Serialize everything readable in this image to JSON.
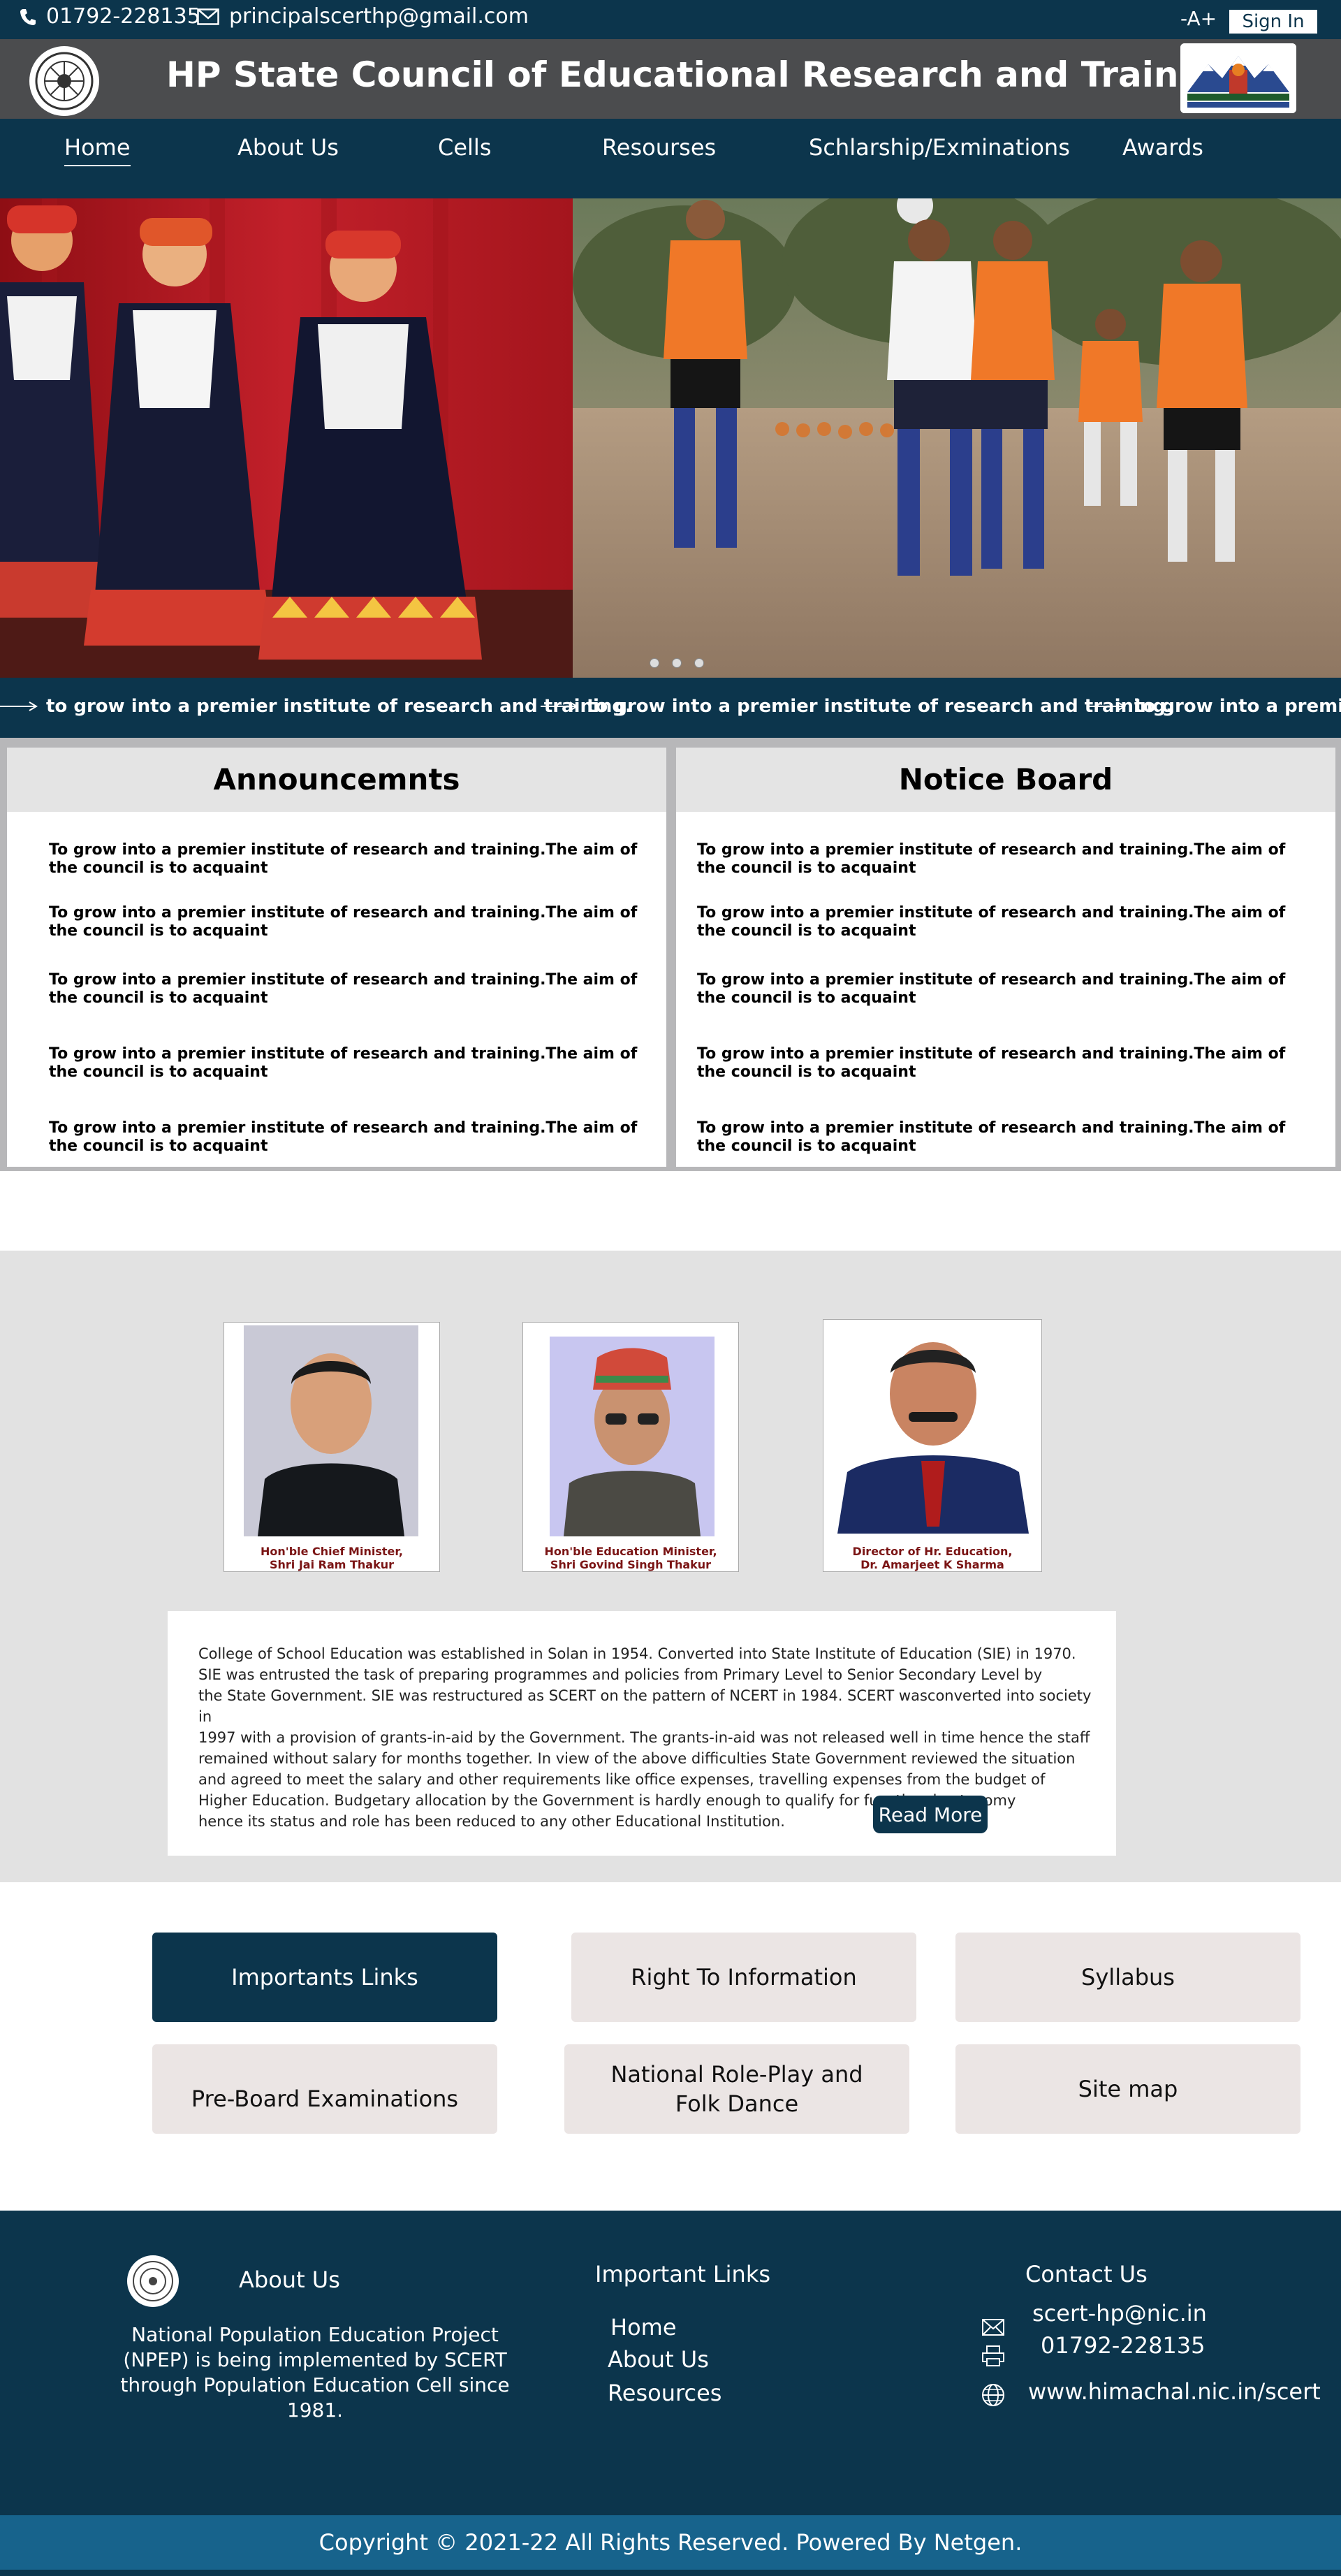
{
  "topbar": {
    "phone": "01792-228135",
    "email": "principalscerthp@gmail.com",
    "font_size_control": "-A+",
    "sign_in": "Sign In"
  },
  "header": {
    "title": "HP State Council of Educational Research and Training"
  },
  "nav": {
    "items": [
      {
        "label": "Home",
        "active": true
      },
      {
        "label": "About Us"
      },
      {
        "label": "Cells"
      },
      {
        "label": "Resourses"
      },
      {
        "label": "Schlarship/Exminations"
      },
      {
        "label": "Awards"
      }
    ]
  },
  "hero": {
    "slide_count": 3,
    "active_slide": 1
  },
  "ticker": {
    "message": "to grow into a premier institute of research and training.",
    "partial": "to grow into a premier ins"
  },
  "announcements": {
    "title": "Announcemnts",
    "entries": [
      "To grow into a premier institute of research and training.The aim of the council is to acquaint",
      "To grow into a premier institute of research and training.The aim of the council is to acquaint",
      "To grow into a premier institute of research and training.The aim of the council is to acquaint",
      "To grow into a premier institute of research and training.The aim of the council is to acquaint",
      "To grow into a premier institute of research and training.The aim of the council is to acquaint"
    ]
  },
  "notice_board": {
    "title": "Notice Board",
    "entries": [
      "To grow into a premier institute of research and training.The aim of the council is to acquaint",
      "To grow into a premier institute of research and training.The aim of the council is to acquaint",
      "To grow into a premier institute of research and training.The aim of the council is to acquaint",
      "To grow into a premier institute of research and training.The aim of the council is to acquaint",
      "To grow into a premier institute of research and training.The aim of the council is to acquaint"
    ]
  },
  "officials": [
    {
      "caption_line1": "Hon'ble Chief Minister,",
      "caption_line2": "Shri Jai Ram Thakur"
    },
    {
      "caption_line1": "Hon'ble Education Minister,",
      "caption_line2": "Shri Govind Singh Thakur"
    },
    {
      "caption_line1": "Director of Hr. Education,",
      "caption_line2": "Dr. Amarjeet K Sharma"
    }
  ],
  "about": {
    "text": "College of School Education was established in Solan in 1954. Converted into State Institute of Education (SIE) in 1970.\nSIE was entrusted the task of preparing programmes and policies from Primary Level to Senior Secondary Level by\nthe State Government. SIE was restructured as SCERT on the pattern of NCERT in 1984. SCERT wasconverted into society in\n1997 with a provision of grants-in-aid by the Government. The grants-in-aid was not released well in time hence the staff\nremained without salary for months together. In view of the above difficulties State Government reviewed the situation\nand agreed to meet the salary and other requirements like office expenses, travelling expenses from the budget of\n Higher Education. Budgetary allocation by the Government is hardly enough to qualify for functional autonomy\nhence its status and role has been reduced to any other Educational Institution.",
    "read_more": "Read More"
  },
  "quick_links": [
    "Importants Links",
    "Right To Information",
    "Syllabus",
    "Pre-Board Examinations",
    "National Role-Play and\nFolk Dance",
    "Site map"
  ],
  "footer": {
    "about_title": "About Us",
    "about_text": "National Population Education Project\n(NPEP) is being implemented by SCERT\nthrough Population Education Cell since 1981.",
    "links_title": "Important Links",
    "links": [
      "Home",
      "About Us",
      "Resources"
    ],
    "contact_title": "Contact Us",
    "contact_email": "scert-hp@nic.in",
    "contact_phone": "01792-228135",
    "contact_web": "www.himachal.nic.in/scert",
    "copyright": "Copyright © 2021-22 All Rights Reserved. Powered By Netgen."
  },
  "colors": {
    "navy": "#0c354c",
    "header_gray": "#4b4c4e",
    "copyright_blue": "#17638c",
    "caption_red": "#7a1414"
  }
}
